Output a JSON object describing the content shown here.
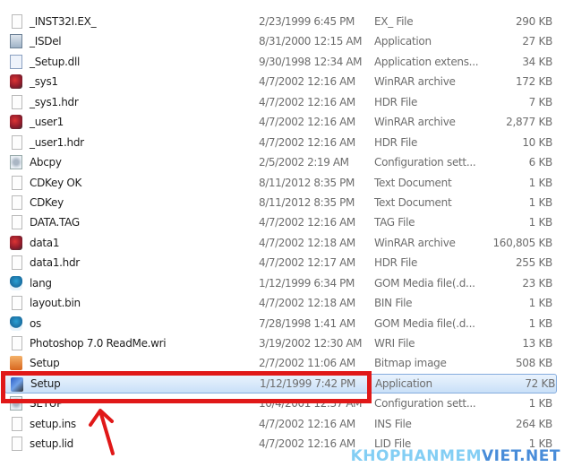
{
  "files": [
    {
      "name": "_INST32I.EX_",
      "date": "2/23/1999 6:45 PM",
      "type": "EX_ File",
      "size": "290 KB",
      "icon": "file-icon"
    },
    {
      "name": "_ISDel",
      "date": "8/31/2000 12:15 AM",
      "type": "Application",
      "size": "27 KB",
      "icon": "application-icon"
    },
    {
      "name": "_Setup.dll",
      "date": "9/30/1998 12:34 AM",
      "type": "Application extens...",
      "size": "34 KB",
      "icon": "dll-icon"
    },
    {
      "name": "_sys1",
      "date": "4/7/2002 12:16 AM",
      "type": "WinRAR archive",
      "size": "172 KB",
      "icon": "winrar-icon"
    },
    {
      "name": "_sys1.hdr",
      "date": "4/7/2002 12:16 AM",
      "type": "HDR File",
      "size": "7 KB",
      "icon": "file-icon"
    },
    {
      "name": "_user1",
      "date": "4/7/2002 12:16 AM",
      "type": "WinRAR archive",
      "size": "2,877 KB",
      "icon": "winrar-icon"
    },
    {
      "name": "_user1.hdr",
      "date": "4/7/2002 12:16 AM",
      "type": "HDR File",
      "size": "10 KB",
      "icon": "file-icon"
    },
    {
      "name": "Abcpy",
      "date": "2/5/2002 2:19 AM",
      "type": "Configuration sett...",
      "size": "6 KB",
      "icon": "config-icon"
    },
    {
      "name": "CDKey OK",
      "date": "8/11/2012 8:35 PM",
      "type": "Text Document",
      "size": "1 KB",
      "icon": "file-icon"
    },
    {
      "name": "CDKey",
      "date": "8/11/2012 8:35 PM",
      "type": "Text Document",
      "size": "1 KB",
      "icon": "file-icon"
    },
    {
      "name": "DATA.TAG",
      "date": "4/7/2002 12:16 AM",
      "type": "TAG File",
      "size": "1 KB",
      "icon": "file-icon"
    },
    {
      "name": "data1",
      "date": "4/7/2002 12:18 AM",
      "type": "WinRAR archive",
      "size": "160,805 KB",
      "icon": "winrar-icon"
    },
    {
      "name": "data1.hdr",
      "date": "4/7/2002 12:17 AM",
      "type": "HDR File",
      "size": "255 KB",
      "icon": "file-icon"
    },
    {
      "name": "lang",
      "date": "1/12/1999 6:34 PM",
      "type": "GOM Media file(.d...",
      "size": "23 KB",
      "icon": "gom-media-icon"
    },
    {
      "name": "layout.bin",
      "date": "4/7/2002 12:18 AM",
      "type": "BIN File",
      "size": "1 KB",
      "icon": "file-icon"
    },
    {
      "name": "os",
      "date": "7/28/1998 1:41 AM",
      "type": "GOM Media file(.d...",
      "size": "1 KB",
      "icon": "gom-media-icon"
    },
    {
      "name": "Photoshop 7.0 ReadMe.wri",
      "date": "3/19/2002 12:30 AM",
      "type": "WRI File",
      "size": "13 KB",
      "icon": "file-icon"
    },
    {
      "name": "Setup",
      "date": "2/7/2002 11:06 AM",
      "type": "Bitmap image",
      "size": "508 KB",
      "icon": "bitmap-icon"
    },
    {
      "name": "Setup",
      "date": "1/12/1999 7:42 PM",
      "type": "Application",
      "size": "72 KB",
      "icon": "setup-application-icon",
      "selected": true
    },
    {
      "name": "SETUP",
      "date": "10/4/2001 12:37 AM",
      "type": "Configuration sett...",
      "size": "1 KB",
      "icon": "config-icon"
    },
    {
      "name": "setup.ins",
      "date": "4/7/2002 12:16 AM",
      "type": "INS File",
      "size": "264 KB",
      "icon": "file-icon"
    },
    {
      "name": "setup.lid",
      "date": "4/7/2002 12:16 AM",
      "type": "LID File",
      "size": "1 KB",
      "icon": "file-icon"
    }
  ],
  "annotation": {
    "highlight_color": "#e01818"
  },
  "watermark": {
    "part1": "KHOPHANMEM",
    "part2": "VIET.NET"
  }
}
